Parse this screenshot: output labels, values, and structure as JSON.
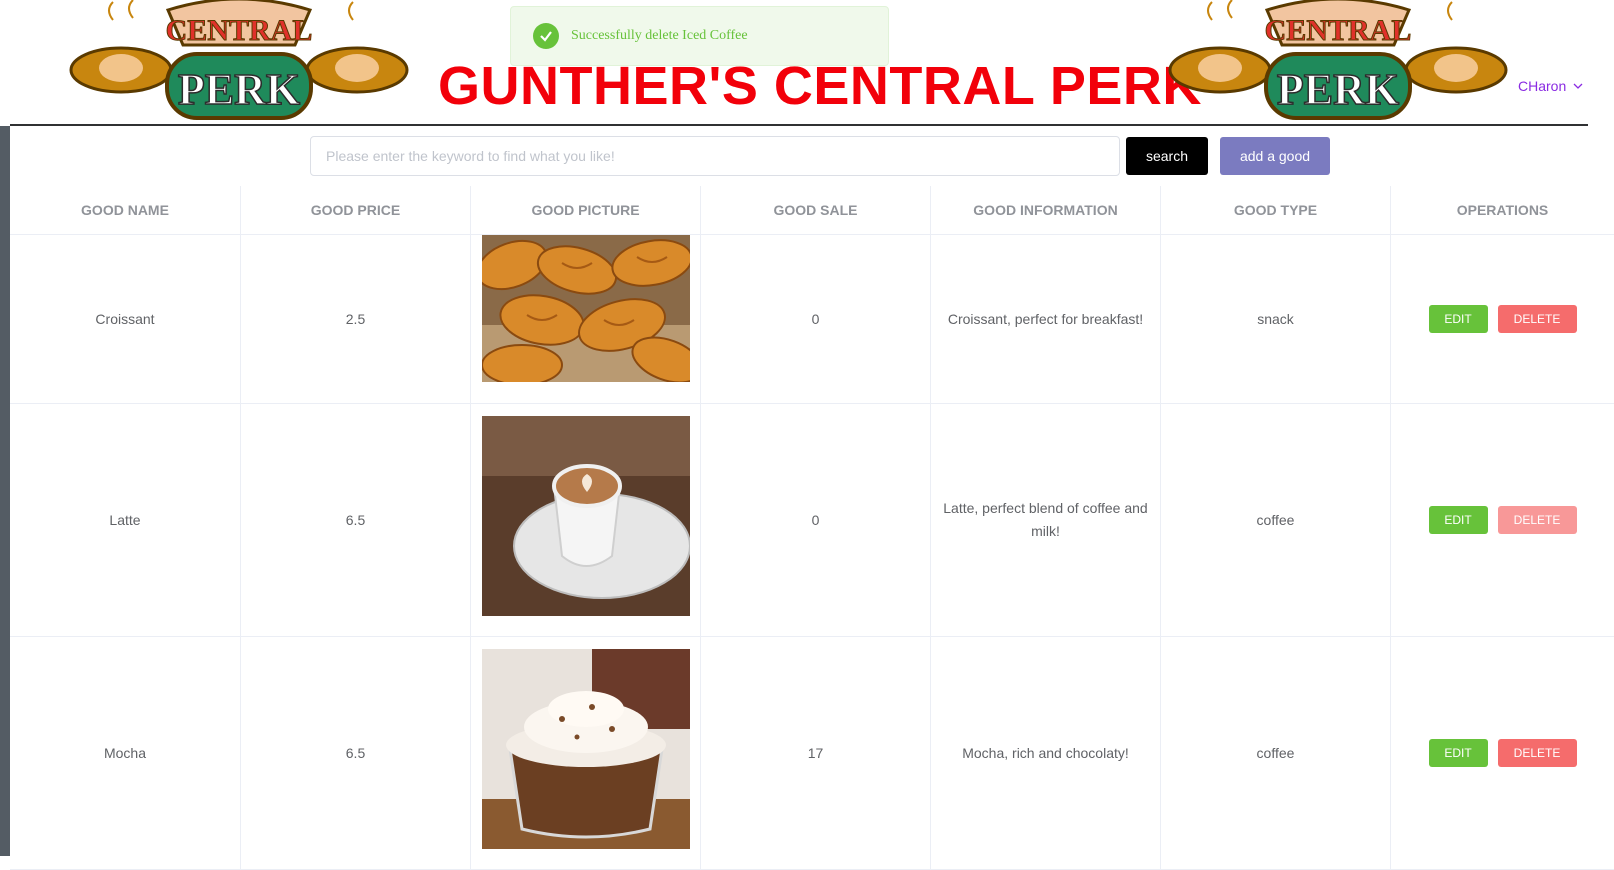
{
  "header": {
    "title": "GUNTHER'S CENTRAL PERK",
    "logo_top_text": "CENTRAL",
    "logo_bottom_text": "PERK",
    "user_name": "CHaron",
    "colors": {
      "title": "#f2000a",
      "user": "#8a2be2",
      "logo_green": "#1f8a5b",
      "logo_red": "#e0312a",
      "cup": "#c8860f"
    }
  },
  "toast": {
    "message": "Successfully delete Iced Coffee",
    "icon": "check-circle-icon",
    "color": "#67c23a"
  },
  "toolbar": {
    "search_placeholder": "Please enter the keyword to find what you like!",
    "search_value": "",
    "search_label": "search",
    "add_label": "add a good"
  },
  "table": {
    "columns": [
      "GOOD NAME",
      "GOOD PRICE",
      "GOOD PICTURE",
      "GOOD SALE",
      "GOOD INFORMATION",
      "GOOD TYPE",
      "OPERATIONS"
    ],
    "rows": [
      {
        "name": "Croissant",
        "price": "2.5",
        "picture": "croissant-image",
        "sale": "0",
        "info": "Croissant, perfect for breakfast!",
        "type": "snack",
        "edit": "EDIT",
        "delete": "DELETE"
      },
      {
        "name": "Latte",
        "price": "6.5",
        "picture": "latte-image",
        "sale": "0",
        "info": "Latte, perfect blend of coffee and milk!",
        "type": "coffee",
        "edit": "EDIT",
        "delete": "DELETE"
      },
      {
        "name": "Mocha",
        "price": "6.5",
        "picture": "mocha-image",
        "sale": "17",
        "info": "Mocha, rich and chocolaty!",
        "type": "coffee",
        "edit": "EDIT",
        "delete": "DELETE"
      }
    ]
  },
  "colors": {
    "edit": "#67c23a",
    "delete": "#f56c6c",
    "search_btn": "#000000",
    "add_btn": "#7b7bc0",
    "sidebar": "#545c64"
  }
}
